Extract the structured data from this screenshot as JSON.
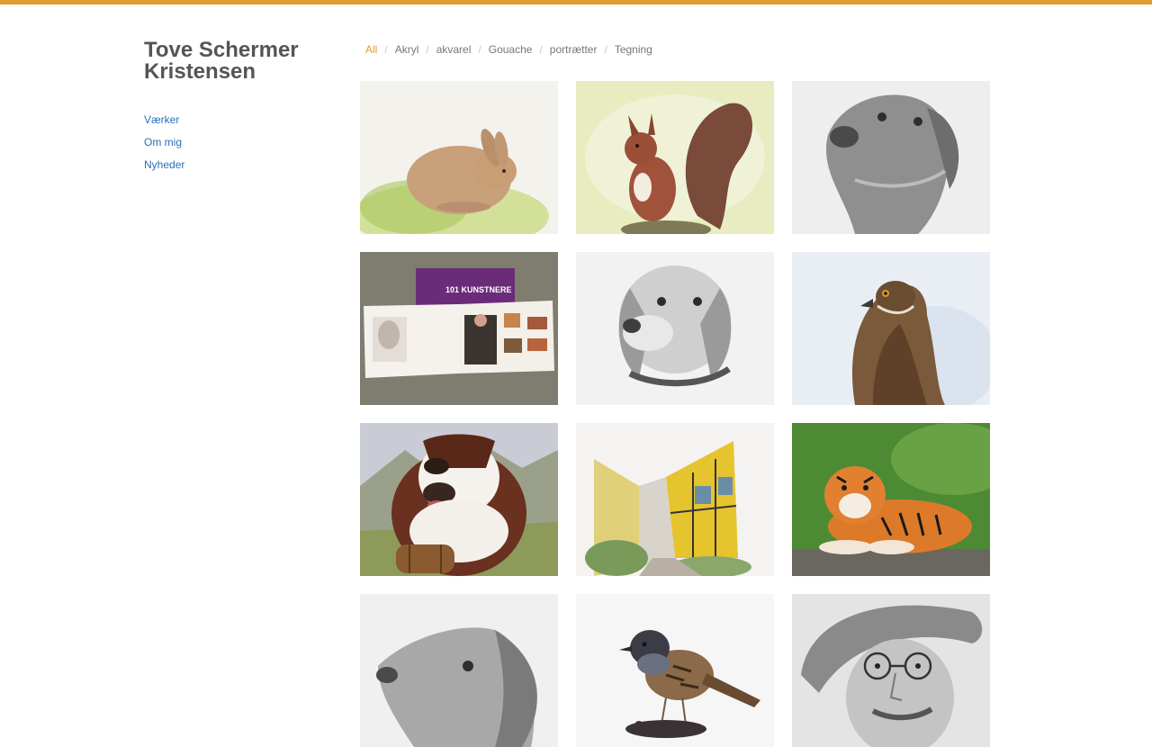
{
  "site": {
    "title_line1": "Tove Schermer",
    "title_line2": "Kristensen",
    "accent_color": "#e39b2e",
    "link_color": "#2a6fb8"
  },
  "nav": [
    {
      "label": "Værker"
    },
    {
      "label": "Om mig"
    },
    {
      "label": "Nyheder"
    }
  ],
  "filters": {
    "active": "All",
    "items": [
      "All",
      "Akryl",
      "akvarel",
      "Gouache",
      "portrætter",
      "Tegning"
    ]
  },
  "gallery": [
    {
      "subject": "rabbit",
      "icon": "rabbit-painting"
    },
    {
      "subject": "squirrel",
      "icon": "squirrel-painting"
    },
    {
      "subject": "dog-sketch",
      "icon": "dog-pencil-drawing"
    },
    {
      "subject": "book",
      "icon": "open-book-photo"
    },
    {
      "subject": "beagle-sketch",
      "icon": "beagle-pencil-drawing"
    },
    {
      "subject": "hawk",
      "icon": "hawk-painting"
    },
    {
      "subject": "st-bernard",
      "icon": "st-bernard-painting"
    },
    {
      "subject": "street",
      "icon": "yellow-house-street-painting"
    },
    {
      "subject": "tiger",
      "icon": "tiger-painting"
    },
    {
      "subject": "setter-sketch",
      "icon": "setter-pencil-drawing"
    },
    {
      "subject": "bird",
      "icon": "dunnock-bird-painting"
    },
    {
      "subject": "old-man",
      "icon": "old-man-portrait-drawing"
    }
  ]
}
